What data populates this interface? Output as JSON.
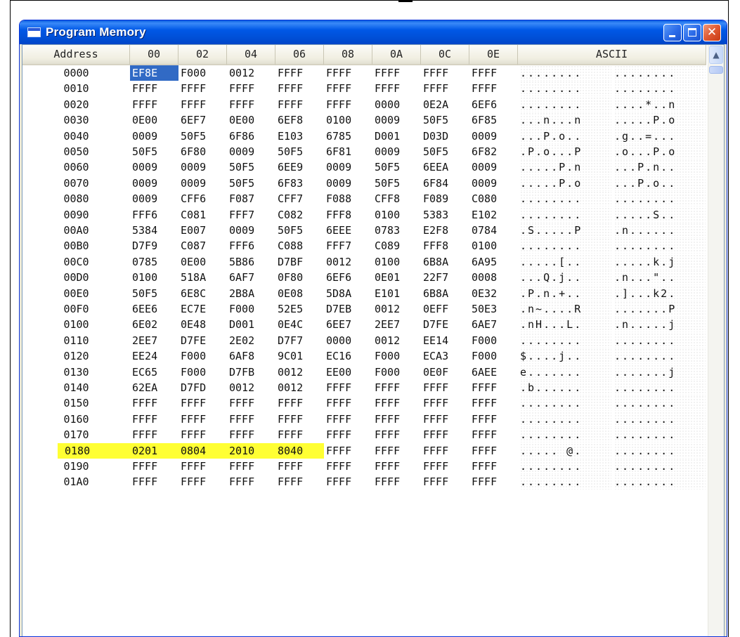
{
  "window": {
    "title": "Program Memory"
  },
  "titlebar_buttons": {
    "minimize_icon": "minimize-icon",
    "maximize_icon": "maximize-icon",
    "close_icon": "close-icon",
    "close_glyph": "✕"
  },
  "columns": [
    "Address",
    "00",
    "02",
    "04",
    "06",
    "08",
    "0A",
    "0C",
    "0E",
    "ASCII"
  ],
  "scrollbar": {
    "up_arrow": "▲"
  },
  "highlight_color": "#ffff33",
  "selection_color": "#316ac5",
  "rows": [
    {
      "addr": "0000",
      "words": [
        "EF8E",
        "F000",
        "0012",
        "FFFF",
        "FFFF",
        "FFFF",
        "FFFF",
        "FFFF"
      ],
      "ascii1": "........",
      "ascii2": "........"
    },
    {
      "addr": "0010",
      "words": [
        "FFFF",
        "FFFF",
        "FFFF",
        "FFFF",
        "FFFF",
        "FFFF",
        "FFFF",
        "FFFF"
      ],
      "ascii1": "........",
      "ascii2": "........"
    },
    {
      "addr": "0020",
      "words": [
        "FFFF",
        "FFFF",
        "FFFF",
        "FFFF",
        "FFFF",
        "0000",
        "0E2A",
        "6EF6"
      ],
      "ascii1": "........",
      "ascii2": "....*..n"
    },
    {
      "addr": "0030",
      "words": [
        "0E00",
        "6EF7",
        "0E00",
        "6EF8",
        "0100",
        "0009",
        "50F5",
        "6F85"
      ],
      "ascii1": "...n...n",
      "ascii2": ".....P.o"
    },
    {
      "addr": "0040",
      "words": [
        "0009",
        "50F5",
        "6F86",
        "E103",
        "6785",
        "D001",
        "D03D",
        "0009"
      ],
      "ascii1": "...P.o..",
      "ascii2": ".g..=..."
    },
    {
      "addr": "0050",
      "words": [
        "50F5",
        "6F80",
        "0009",
        "50F5",
        "6F81",
        "0009",
        "50F5",
        "6F82"
      ],
      "ascii1": ".P.o...P",
      "ascii2": ".o...P.o"
    },
    {
      "addr": "0060",
      "words": [
        "0009",
        "0009",
        "50F5",
        "6EE9",
        "0009",
        "50F5",
        "6EEA",
        "0009"
      ],
      "ascii1": ".....P.n",
      "ascii2": "...P.n.."
    },
    {
      "addr": "0070",
      "words": [
        "0009",
        "0009",
        "50F5",
        "6F83",
        "0009",
        "50F5",
        "6F84",
        "0009"
      ],
      "ascii1": ".....P.o",
      "ascii2": "...P.o.."
    },
    {
      "addr": "0080",
      "words": [
        "0009",
        "CFF6",
        "F087",
        "CFF7",
        "F088",
        "CFF8",
        "F089",
        "C080"
      ],
      "ascii1": "........",
      "ascii2": "........"
    },
    {
      "addr": "0090",
      "words": [
        "FFF6",
        "C081",
        "FFF7",
        "C082",
        "FFF8",
        "0100",
        "5383",
        "E102"
      ],
      "ascii1": "........",
      "ascii2": ".....S.."
    },
    {
      "addr": "00A0",
      "words": [
        "5384",
        "E007",
        "0009",
        "50F5",
        "6EEE",
        "0783",
        "E2F8",
        "0784"
      ],
      "ascii1": ".S.....P",
      "ascii2": ".n......"
    },
    {
      "addr": "00B0",
      "words": [
        "D7F9",
        "C087",
        "FFF6",
        "C088",
        "FFF7",
        "C089",
        "FFF8",
        "0100"
      ],
      "ascii1": "........",
      "ascii2": "........"
    },
    {
      "addr": "00C0",
      "words": [
        "0785",
        "0E00",
        "5B86",
        "D7BF",
        "0012",
        "0100",
        "6B8A",
        "6A95"
      ],
      "ascii1": ".....[..",
      "ascii2": ".....k.j"
    },
    {
      "addr": "00D0",
      "words": [
        "0100",
        "518A",
        "6AF7",
        "0F80",
        "6EF6",
        "0E01",
        "22F7",
        "0008"
      ],
      "ascii1": "...Q.j..",
      "ascii2": ".n...\".."
    },
    {
      "addr": "00E0",
      "words": [
        "50F5",
        "6E8C",
        "2B8A",
        "0E08",
        "5D8A",
        "E101",
        "6B8A",
        "0E32"
      ],
      "ascii1": ".P.n.+..",
      "ascii2": ".]...k2."
    },
    {
      "addr": "00F0",
      "words": [
        "6EE6",
        "EC7E",
        "F000",
        "52E5",
        "D7EB",
        "0012",
        "0EFF",
        "50E3"
      ],
      "ascii1": ".n~....R",
      "ascii2": ".......P"
    },
    {
      "addr": "0100",
      "words": [
        "6E02",
        "0E48",
        "D001",
        "0E4C",
        "6EE7",
        "2EE7",
        "D7FE",
        "6AE7"
      ],
      "ascii1": ".nH...L.",
      "ascii2": ".n.....j"
    },
    {
      "addr": "0110",
      "words": [
        "2EE7",
        "D7FE",
        "2E02",
        "D7F7",
        "0000",
        "0012",
        "EE14",
        "F000"
      ],
      "ascii1": "........",
      "ascii2": "........"
    },
    {
      "addr": "0120",
      "words": [
        "EE24",
        "F000",
        "6AF8",
        "9C01",
        "EC16",
        "F000",
        "ECA3",
        "F000"
      ],
      "ascii1": "$....j..",
      "ascii2": "........"
    },
    {
      "addr": "0130",
      "words": [
        "EC65",
        "F000",
        "D7FB",
        "0012",
        "EE00",
        "F000",
        "0E0F",
        "6AEE"
      ],
      "ascii1": "e.......",
      "ascii2": ".......j"
    },
    {
      "addr": "0140",
      "words": [
        "62EA",
        "D7FD",
        "0012",
        "0012",
        "FFFF",
        "FFFF",
        "FFFF",
        "FFFF"
      ],
      "ascii1": ".b......",
      "ascii2": "........"
    },
    {
      "addr": "0150",
      "words": [
        "FFFF",
        "FFFF",
        "FFFF",
        "FFFF",
        "FFFF",
        "FFFF",
        "FFFF",
        "FFFF"
      ],
      "ascii1": "........",
      "ascii2": "........"
    },
    {
      "addr": "0160",
      "words": [
        "FFFF",
        "FFFF",
        "FFFF",
        "FFFF",
        "FFFF",
        "FFFF",
        "FFFF",
        "FFFF"
      ],
      "ascii1": "........",
      "ascii2": "........"
    },
    {
      "addr": "0170",
      "words": [
        "FFFF",
        "FFFF",
        "FFFF",
        "FFFF",
        "FFFF",
        "FFFF",
        "FFFF",
        "FFFF"
      ],
      "ascii1": "........",
      "ascii2": "........"
    },
    {
      "addr": "0180",
      "words": [
        "0201",
        "0804",
        "2010",
        "8040",
        "FFFF",
        "FFFF",
        "FFFF",
        "FFFF"
      ],
      "ascii1": "..... @.",
      "ascii2": "........",
      "highlight": true
    },
    {
      "addr": "0190",
      "words": [
        "FFFF",
        "FFFF",
        "FFFF",
        "FFFF",
        "FFFF",
        "FFFF",
        "FFFF",
        "FFFF"
      ],
      "ascii1": "........",
      "ascii2": "........"
    },
    {
      "addr": "01A0",
      "words": [
        "FFFF",
        "FFFF",
        "FFFF",
        "FFFF",
        "FFFF",
        "FFFF",
        "FFFF",
        "FFFF"
      ],
      "ascii1": "........",
      "ascii2": "........"
    }
  ]
}
